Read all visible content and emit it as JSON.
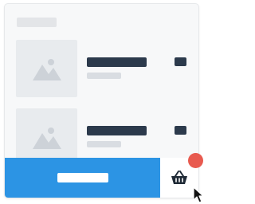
{
  "colors": {
    "accent": "#2c94e4",
    "badge": "#e85a4f",
    "text_placeholder_dark": "#2c3a4c",
    "text_placeholder_light": "#d9dde2",
    "image_placeholder": "#e8ebee"
  },
  "header": {
    "placeholder": "text-skeleton"
  },
  "products": [
    {
      "image_icon": "image-placeholder-icon",
      "title": "",
      "subtitle": "",
      "price": ""
    },
    {
      "image_icon": "image-placeholder-icon",
      "title": "",
      "subtitle": "",
      "price": ""
    }
  ],
  "footer": {
    "primary_button_label": "",
    "cart_icon": "shopping-basket-icon",
    "cart_badge": ""
  }
}
